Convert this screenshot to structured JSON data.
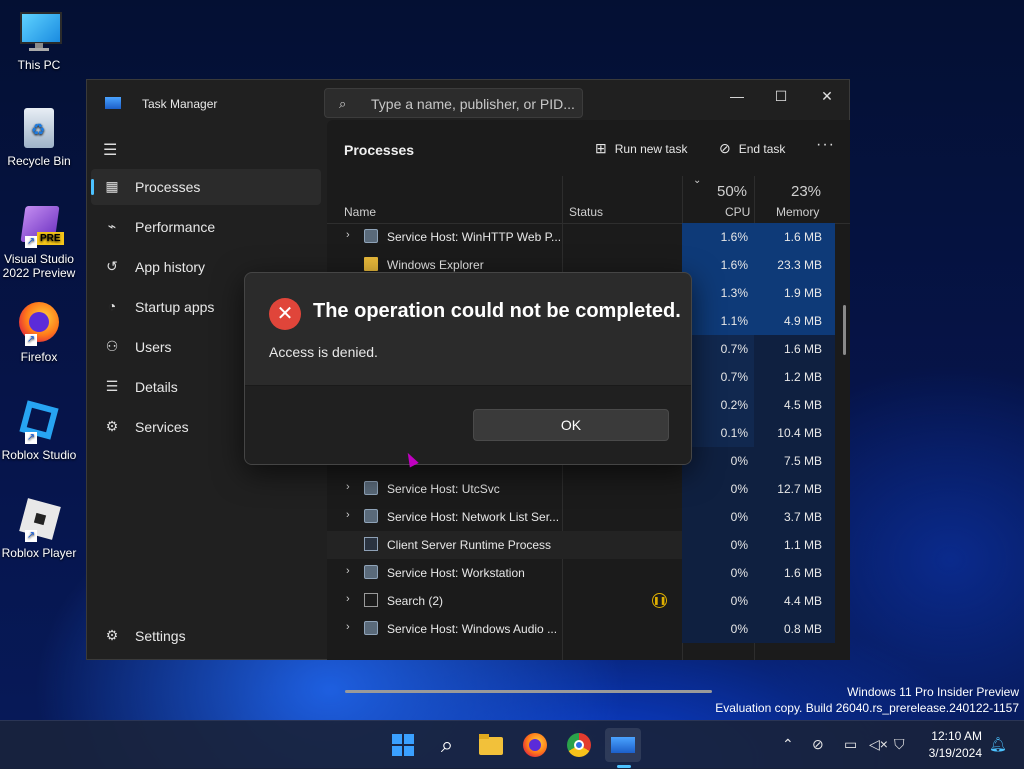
{
  "desktop": {
    "icons": [
      {
        "label": "This PC",
        "icon": "monitor-icon"
      },
      {
        "label": "Recycle Bin",
        "icon": "recycle-bin-icon"
      },
      {
        "label": "Visual Studio 2022 Preview",
        "badge": "PRE",
        "icon": "visual-studio-icon"
      },
      {
        "label": "Firefox",
        "icon": "firefox-icon"
      },
      {
        "label": "Roblox Studio",
        "icon": "roblox-studio-icon"
      },
      {
        "label": "Roblox Player",
        "icon": "roblox-player-icon"
      }
    ],
    "watermark": {
      "line1": "Windows 11 Pro Insider Preview",
      "line2": "Evaluation copy. Build 26040.rs_prerelease.240122-1157"
    }
  },
  "task_manager": {
    "title": "Task Manager",
    "search_placeholder": "Type a name, publisher, or PID...",
    "window_controls": {
      "minimize": "—",
      "maximize": "☐",
      "close": "✕"
    },
    "nav": [
      {
        "label": "Processes",
        "icon": "processes-icon",
        "active": true
      },
      {
        "label": "Performance",
        "icon": "performance-icon"
      },
      {
        "label": "App history",
        "icon": "app-history-icon"
      },
      {
        "label": "Startup apps",
        "icon": "startup-apps-icon"
      },
      {
        "label": "Users",
        "icon": "users-icon"
      },
      {
        "label": "Details",
        "icon": "details-icon"
      },
      {
        "label": "Services",
        "icon": "services-icon"
      }
    ],
    "settings_label": "Settings",
    "page_title": "Processes",
    "commands": {
      "run_new_task": "Run new task",
      "end_task": "End task",
      "more": "···"
    },
    "columns": {
      "name": "Name",
      "status": "Status",
      "cpu_pct": "50%",
      "cpu": "CPU",
      "mem_pct": "23%",
      "memory": "Memory"
    },
    "rows": [
      {
        "name": "Service Host: WinHTTP Web P...",
        "cpu": "1.6%",
        "mem": "1.6 MB",
        "expand": true,
        "icon": "gear"
      },
      {
        "name": "Windows Explorer",
        "cpu": "1.6%",
        "mem": "23.3 MB",
        "expand": false,
        "icon": "folder"
      },
      {
        "name": "",
        "cpu": "1.3%",
        "mem": "1.9 MB"
      },
      {
        "name": "",
        "cpu": "1.1%",
        "mem": "4.9 MB"
      },
      {
        "name": "",
        "cpu": "0.7%",
        "mem": "1.6 MB"
      },
      {
        "name": "",
        "cpu": "0.7%",
        "mem": "1.2 MB"
      },
      {
        "name": "",
        "cpu": "0.2%",
        "mem": "4.5 MB"
      },
      {
        "name": "",
        "cpu": "0.1%",
        "mem": "10.4 MB"
      },
      {
        "name": "",
        "cpu": "0%",
        "mem": "7.5 MB"
      },
      {
        "name": "Service Host: UtcSvc",
        "cpu": "0%",
        "mem": "12.7 MB",
        "expand": true,
        "icon": "gear"
      },
      {
        "name": "Service Host: Network List Ser...",
        "cpu": "0%",
        "mem": "3.7 MB",
        "expand": true,
        "icon": "gear"
      },
      {
        "name": "Client Server Runtime Process",
        "cpu": "0%",
        "mem": "1.1 MB",
        "expand": false,
        "icon": "winapp",
        "selected": true
      },
      {
        "name": "Service Host: Workstation",
        "cpu": "0%",
        "mem": "1.6 MB",
        "expand": true,
        "icon": "gear"
      },
      {
        "name": "Search (2)",
        "cpu": "0%",
        "mem": "4.4 MB",
        "expand": true,
        "icon": "search",
        "status_icon": "suspended-icon"
      },
      {
        "name": "Service Host: Windows Audio ...",
        "cpu": "0%",
        "mem": "0.8 MB",
        "expand": true,
        "icon": "gear"
      }
    ]
  },
  "dialog": {
    "title": "The operation could not be completed.",
    "message": "Access is denied.",
    "ok_label": "OK",
    "error_icon_glyph": "✕"
  },
  "taskbar": {
    "time": "12:10 AM",
    "date": "3/19/2024",
    "apps": [
      "start-icon",
      "search-icon",
      "file-explorer-icon",
      "firefox-icon",
      "chrome-icon",
      "task-manager-icon"
    ],
    "tray": [
      "chevron-up-icon",
      "network-off-icon",
      "display-icon",
      "volume-muted-icon",
      "security-icon",
      "notification-bell-icon"
    ]
  },
  "colors": {
    "accent": "#4cc2ff",
    "error": "#e0453a",
    "cpu_highlight": "#0e3a78"
  }
}
